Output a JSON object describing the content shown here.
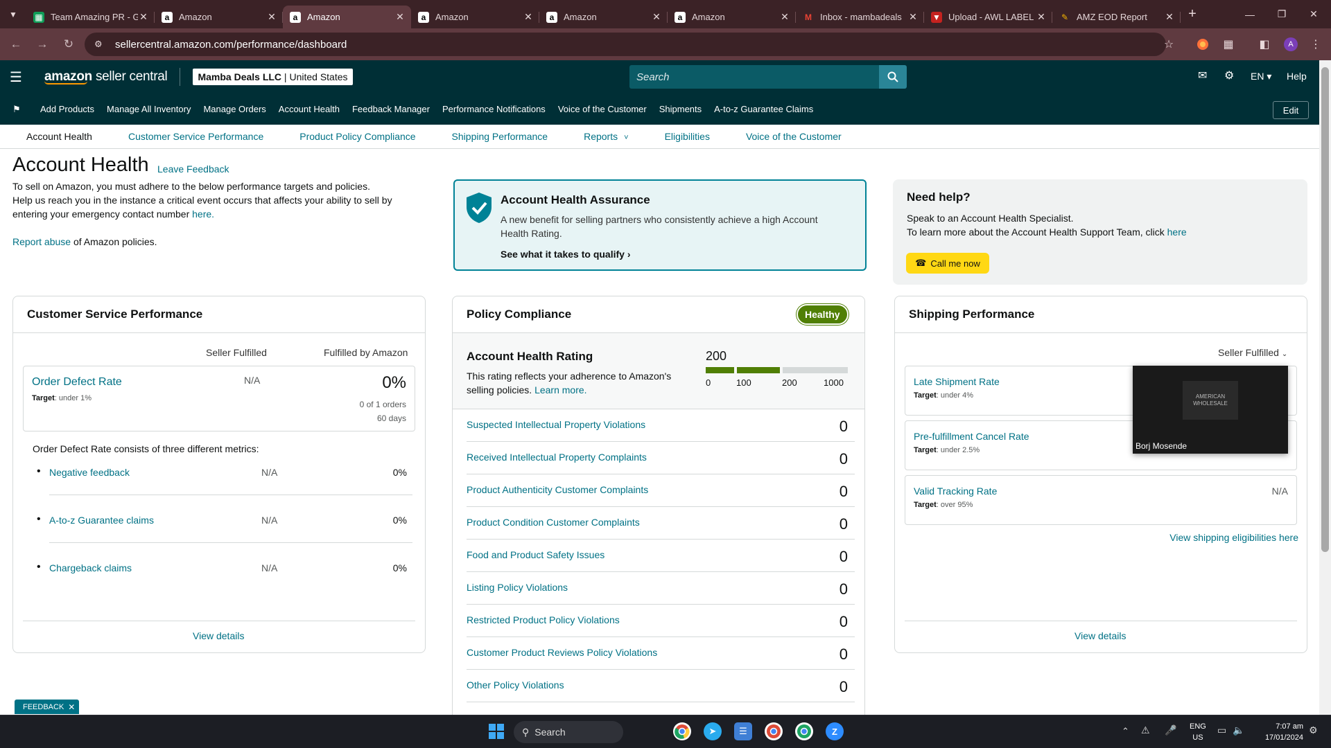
{
  "browser": {
    "tabs": [
      {
        "title": "Team Amazing PR - G",
        "icon": "sheets-icon",
        "active": false
      },
      {
        "title": "Amazon",
        "icon": "amazon-icon",
        "active": false
      },
      {
        "title": "Amazon",
        "icon": "amazon-icon",
        "active": true
      },
      {
        "title": "Amazon",
        "icon": "amazon-icon",
        "active": false
      },
      {
        "title": "Amazon",
        "icon": "amazon-icon",
        "active": false
      },
      {
        "title": "Amazon",
        "icon": "amazon-icon",
        "active": false
      },
      {
        "title": "Inbox - mambadeals",
        "icon": "gmail-icon",
        "active": false
      },
      {
        "title": "Upload - AWL LABEL",
        "icon": "upload-icon",
        "active": false
      },
      {
        "title": "AMZ EOD Report",
        "icon": "report-icon",
        "active": false
      }
    ],
    "url": "sellercentral.amazon.com/performance/dashboard",
    "profile_initial": "A",
    "theme_color": "#3b2226"
  },
  "header": {
    "logo_text_bold": "amazon",
    "logo_text": "seller central",
    "merchant_name": "Mamba Deals LLC",
    "marketplace": "United States",
    "search_placeholder": "Search",
    "language": "EN",
    "help": "Help"
  },
  "nav": {
    "items": [
      "Add Products",
      "Manage All Inventory",
      "Manage Orders",
      "Account Health",
      "Feedback Manager",
      "Performance Notifications",
      "Voice of the Customer",
      "Shipments",
      "A-to-z Guarantee Claims"
    ],
    "edit": "Edit"
  },
  "subnav": {
    "items": [
      "Account Health",
      "Customer Service Performance",
      "Product Policy Compliance",
      "Shipping Performance",
      "Reports",
      "Eligibilities",
      "Voice of the Customer"
    ]
  },
  "page": {
    "title": "Account Health",
    "leave_feedback": "Leave Feedback",
    "intro_line1": "To sell on Amazon, you must adhere to the below performance targets and policies.",
    "intro_line2": "Help us reach you in the instance a critical event occurs that affects your ability to sell by",
    "intro_line3": "entering your emergency contact number",
    "intro_here": "here.",
    "report_abuse": "Report abuse",
    "report_abuse_suffix": "of Amazon policies."
  },
  "assurance": {
    "title": "Account Health Assurance",
    "body": "A new benefit for selling partners who consistently achieve a high Account Health Rating.",
    "cta": "See what it takes to qualify"
  },
  "help_box": {
    "title": "Need help?",
    "line1": "Speak to an Account Health Specialist.",
    "line2": "To learn more about the Account Health Support Team, click",
    "line2_link": "here",
    "button": "Call me now"
  },
  "csp": {
    "title": "Customer Service Performance",
    "col_seller": "Seller Fulfilled",
    "col_amazon": "Fulfilled by Amazon",
    "odr_label": "Order Defect Rate",
    "odr_target_label": "Target",
    "odr_target": ": under 1%",
    "odr_seller": "N/A",
    "odr_amazon": "0%",
    "odr_orders": "0 of 1 orders",
    "odr_days": "60 days",
    "consists": "Order Defect Rate consists of three different metrics:",
    "metrics": [
      {
        "label": "Negative feedback",
        "seller": "N/A",
        "amazon": "0%"
      },
      {
        "label": "A-to-z Guarantee claims",
        "seller": "N/A",
        "amazon": "0%"
      },
      {
        "label": "Chargeback claims",
        "seller": "N/A",
        "amazon": "0%"
      }
    ],
    "view_details": "View details"
  },
  "policy": {
    "title": "Policy Compliance",
    "badge": "Healthy",
    "rating_title": "Account Health Rating",
    "rating_value": "200",
    "rating_desc1": "This rating reflects your adherence to Amazon's",
    "rating_desc2": "selling policies.",
    "learn_more": "Learn more.",
    "scale": [
      "0",
      "100",
      "200",
      "1000"
    ],
    "rows": [
      {
        "label": "Suspected Intellectual Property Violations",
        "count": "0"
      },
      {
        "label": "Received Intellectual Property Complaints",
        "count": "0"
      },
      {
        "label": "Product Authenticity Customer Complaints",
        "count": "0"
      },
      {
        "label": "Product Condition Customer Complaints",
        "count": "0"
      },
      {
        "label": "Food and Product Safety Issues",
        "count": "0"
      },
      {
        "label": "Listing Policy Violations",
        "count": "0"
      },
      {
        "label": "Restricted Product Policy Violations",
        "count": "0"
      },
      {
        "label": "Customer Product Reviews Policy Violations",
        "count": "0"
      },
      {
        "label": "Other Policy Violations",
        "count": "0"
      }
    ],
    "healthy_color": "#507f05"
  },
  "shipping": {
    "title": "Shipping Performance",
    "filter": "Seller Fulfilled",
    "metrics": [
      {
        "label": "Late Shipment Rate",
        "target": ": under 4%",
        "value": ""
      },
      {
        "label": "Pre-fulfillment Cancel Rate",
        "target": ": under 2.5%",
        "value": ""
      },
      {
        "label": "Valid Tracking Rate",
        "target": ": over 95%",
        "value": "N/A"
      }
    ],
    "target_label": "Target",
    "eligibilities": "View shipping eligibilities here",
    "view_details": "View details"
  },
  "video_overlay": {
    "name": "Borj Mosende",
    "logo_line1": "AMERICAN",
    "logo_line2": "WHOLESALE"
  },
  "feedback_tab": "FEEDBACK",
  "taskbar": {
    "search": "Search",
    "lang1": "ENG",
    "lang2": "US",
    "time": "7:07 am",
    "date": "17/01/2024"
  }
}
